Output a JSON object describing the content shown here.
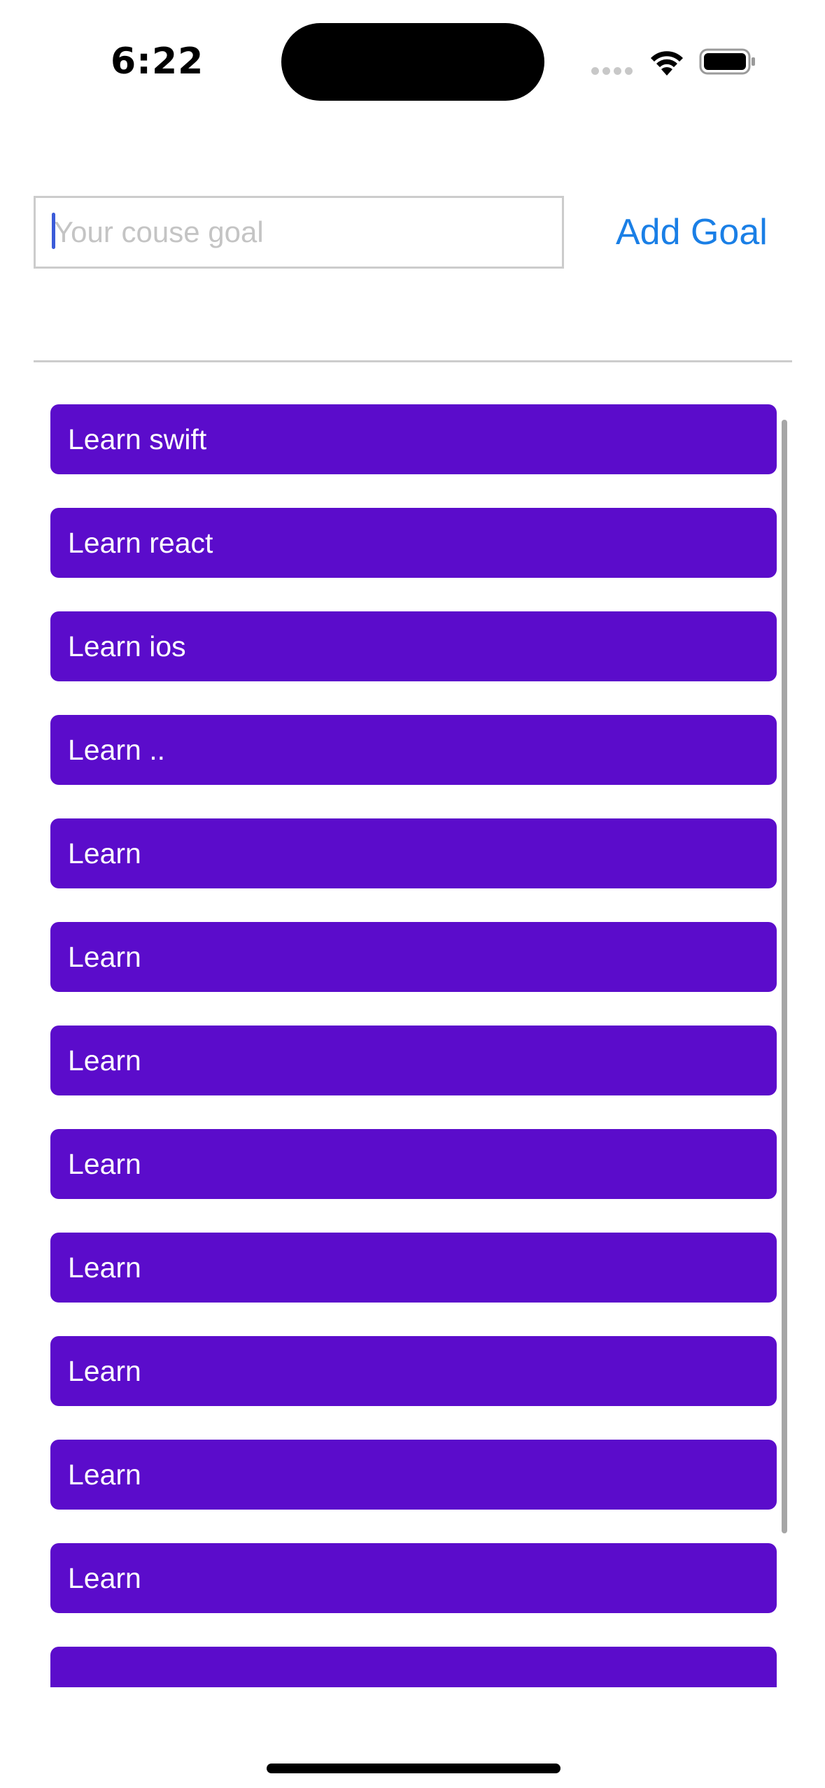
{
  "status_bar": {
    "time": "6:22"
  },
  "input": {
    "placeholder": "Your couse goal",
    "value": ""
  },
  "add_goal_label": "Add Goal",
  "goals": [
    "Learn swift",
    "Learn react",
    "Learn ios",
    "Learn ..",
    "Learn",
    "Learn",
    "Learn",
    "Learn",
    "Learn",
    "Learn",
    "Learn",
    "Learn",
    ""
  ],
  "colors": {
    "goal_background": "#5b0ccb",
    "accent": "#1a7fe6"
  }
}
